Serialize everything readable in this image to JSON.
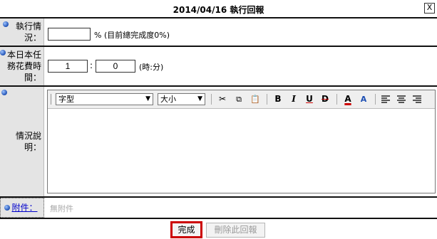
{
  "dialog": {
    "title": "2014/04/16 執行回報",
    "close_label": "X"
  },
  "progress": {
    "label": "執行情況：",
    "value": "",
    "hint": "% (目前總完成度0%)"
  },
  "time": {
    "label": "本日本任務花費時間：",
    "hours": "1",
    "separator": ":",
    "minutes": "0",
    "unit": "(時:分)"
  },
  "description": {
    "label": "情況說明：",
    "font_select": "字型",
    "size_select": "大小",
    "toolbar": {
      "cut": "✂",
      "copy": "⧉",
      "paste": "📋",
      "bold": "B",
      "italic": "I",
      "underline": "U",
      "strike": "D",
      "font_color": "A",
      "bg_color": "A"
    },
    "body": ""
  },
  "attachment": {
    "label": "附件：",
    "value": "無附件"
  },
  "buttons": {
    "submit": "完成",
    "delete": "刪除此回報"
  },
  "colors": {
    "accent_red": "#cc0000",
    "label_bg": "#e4e4e4",
    "bullet_blue": "#1d4fb3"
  }
}
